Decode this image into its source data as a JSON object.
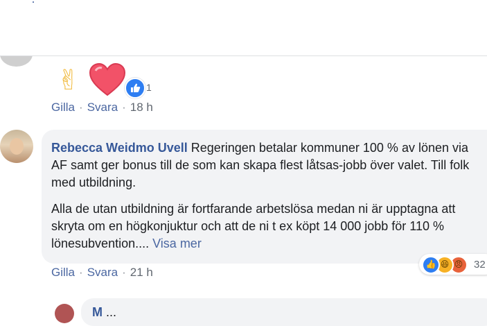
{
  "comments": [
    {
      "reactions_count": "1",
      "actions": {
        "like": "Gilla",
        "reply": "Svara",
        "time": "18 h"
      }
    },
    {
      "author": "Rebecca Weidmo Uvell",
      "paragraph1": "Regeringen betalar kommuner 100 % av lönen via AF samt ger bonus till de som kan skapa flest låtsas-jobb över valet. Till folk med utbildning.",
      "paragraph2": "Alla de utan utbildning är fortfarande arbetslösa medan ni är upptagna att skryta om en högkonjuktur och att de ni t ex köpt 14 000 jobb för 110 % lönesubvention....",
      "see_more": "Visa mer",
      "reactions_count": "32",
      "reaction_icons": [
        "like-icon",
        "haha-icon",
        "angry-icon"
      ],
      "actions": {
        "like": "Gilla",
        "reply": "Svara",
        "time": "21 h"
      }
    },
    {
      "author_partial": "M",
      "text_partial": "..."
    }
  ],
  "colors": {
    "author": "#365899",
    "link": "#4b67a1",
    "meta": "#606770",
    "bubble": "#f2f3f5",
    "like_blue": "#2e7ef2",
    "heart_red": "#f25268"
  }
}
